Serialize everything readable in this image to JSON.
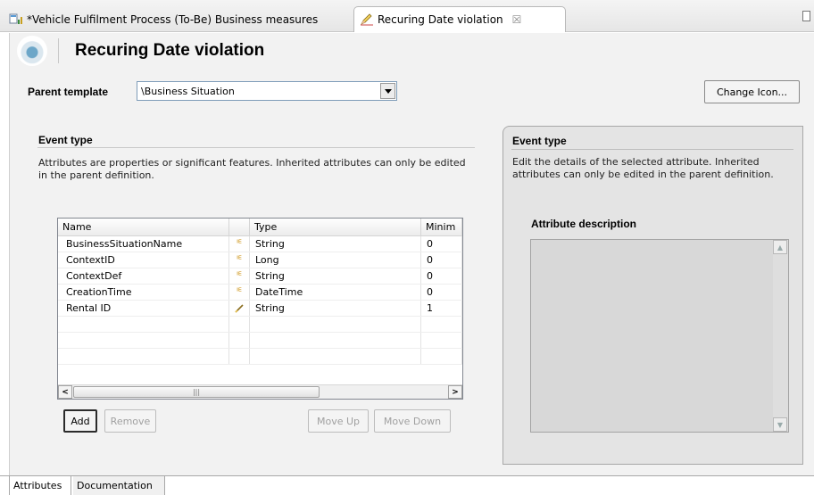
{
  "tabs": [
    {
      "label": "*Vehicle Fulfilment Process (To-Be) Business measures",
      "active": false
    },
    {
      "label": "Recuring Date violation",
      "active": true
    }
  ],
  "icons": {
    "inactive_tab": "business-measures-icon",
    "active_tab": "pencil-event-icon",
    "header": "event-template-icon",
    "inherited": "inherited-attribute-icon",
    "editable": "pencil-icon"
  },
  "header": {
    "title": "Recuring Date violation"
  },
  "parent_template": {
    "label": "Parent template",
    "value": "\\Business Situation"
  },
  "change_icon_label": "Change Icon...",
  "event_type": {
    "title": "Event type",
    "description": "Attributes are properties or significant features. Inherited attributes can only be edited in the parent definition."
  },
  "table": {
    "columns": [
      "Name",
      "",
      "Type",
      "Minim"
    ],
    "rows": [
      {
        "name": "BusinessSituationName",
        "icon": "î",
        "kind": "inherited",
        "type": "String",
        "min": "0"
      },
      {
        "name": "ContextID",
        "icon": "î",
        "kind": "inherited",
        "type": "Long",
        "min": "0"
      },
      {
        "name": "ContextDef",
        "icon": "î",
        "kind": "inherited",
        "type": "String",
        "min": "0"
      },
      {
        "name": "CreationTime",
        "icon": "î",
        "kind": "inherited",
        "type": "DateTime",
        "min": "0"
      },
      {
        "name": "Rental ID",
        "icon": "⁄",
        "kind": "editable",
        "type": "String",
        "min": "1"
      }
    ]
  },
  "buttons": {
    "add": "Add",
    "remove": "Remove",
    "move_up": "Move Up",
    "move_down": "Move Down"
  },
  "details": {
    "title": "Event type",
    "description": "Edit the details of the selected attribute. Inherited attributes can only be edited in the parent definition.",
    "attribute_description_label": "Attribute description"
  },
  "bottom_tabs": [
    "Attributes",
    "Documentation"
  ],
  "colors": {
    "panel_bg": "#f2f2f2",
    "details_bg": "#e4e4e4",
    "inherited_icon": "#c98a00"
  }
}
